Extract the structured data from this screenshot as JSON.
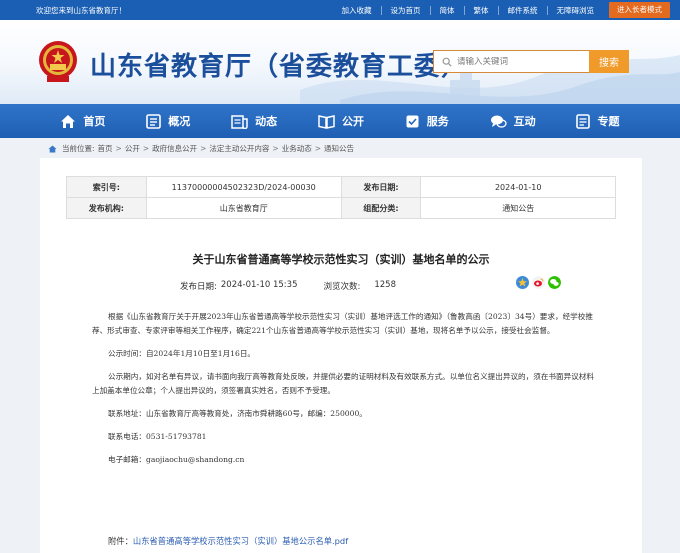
{
  "topbar": {
    "welcome": "欢迎您来到山东省教育厅！",
    "links": [
      "加入收藏",
      "设为首页",
      "简体",
      "繁体",
      "邮件系统",
      "无障碍浏览"
    ],
    "elder_mode": "进入长者模式"
  },
  "header": {
    "title": "山东省教育厅（省委教育工委）",
    "search_placeholder": "请输入关键词",
    "search_button": "搜索"
  },
  "nav": [
    {
      "label": "首页",
      "icon": "home-icon"
    },
    {
      "label": "概况",
      "icon": "overview-icon"
    },
    {
      "label": "动态",
      "icon": "news-icon"
    },
    {
      "label": "公开",
      "icon": "open-book-icon"
    },
    {
      "label": "服务",
      "icon": "service-icon"
    },
    {
      "label": "互动",
      "icon": "chat-icon"
    },
    {
      "label": "专题",
      "icon": "topic-icon"
    }
  ],
  "breadcrumb": {
    "prefix": "当前位置:",
    "items": [
      "首页",
      "公开",
      "政府信息公开",
      "法定主动公开内容",
      "业务动态",
      "通知公告"
    ]
  },
  "meta": {
    "index_label": "索引号:",
    "index_value": "11370000004502323D/2024-00030",
    "date_label": "发布日期:",
    "date_value": "2024-01-10",
    "org_label": "发布机构:",
    "org_value": "山东省教育厅",
    "category_label": "组配分类:",
    "category_value": "通知公告"
  },
  "article": {
    "title": "关于山东省普通高等学校示范性实习（实训）基地名单的公示",
    "pub_label": "发布日期:",
    "pub_value": "2024-01-10 15:35",
    "views_label": "浏览次数:",
    "views_value": "1258",
    "paragraphs": [
      "根据《山东省教育厅关于开展2023年山东省普通高等学校示范性实习（实训）基地评选工作的通知》（鲁教高函〔2023〕34号）要求，经学校推荐、形式审查、专家评审等相关工作程序，确定221个山东省普通高等学校示范性实习（实训）基地，现将名单予以公示，接受社会监督。",
      "公示时间：自2024年1月10日至1月16日。",
      "公示期内，如对名单有异议，请书面向我厅高等教育处反映，并提供必要的证明材料及有效联系方式。以单位名义提出异议的，须在书面异议材料上加盖本单位公章；个人提出异议的，须签署真实姓名，否则不予受理。",
      "联系地址：山东省教育厅高等教育处，济南市舜耕路60号，邮编：250000。",
      "联系电话：0531-51793781",
      "电子邮箱：gaojiaochu@shandong.cn"
    ],
    "attachment_label": "附件：",
    "attachment_link": "山东省普通高等学校示范性实习（实训）基地公示名单.pdf"
  },
  "colors": {
    "brand_blue": "#1a5fb4",
    "title_blue": "#1b4f9c",
    "accent_orange": "#f09a2a",
    "link_blue": "#2a5db0"
  }
}
